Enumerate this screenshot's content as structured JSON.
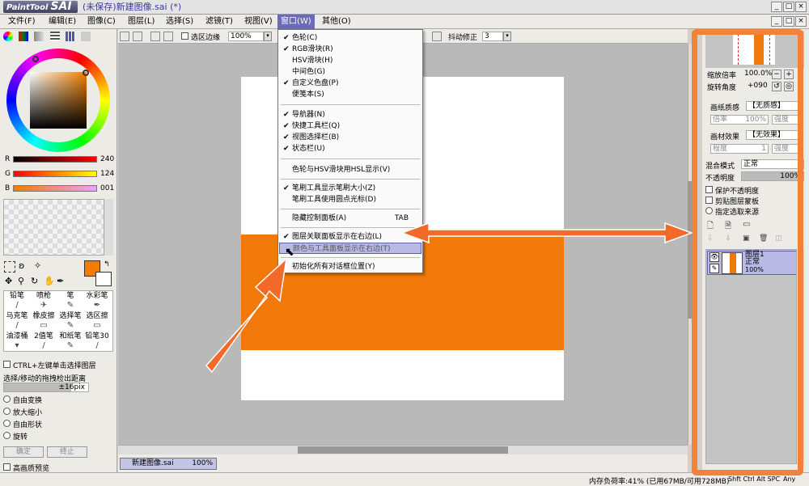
{
  "app": {
    "logo_text": "PaintTool",
    "logo_brand": "SAI",
    "window_title": "(未保存)新建图像.sai (*)"
  },
  "menubar": {
    "items": [
      "文件(F)",
      "编辑(E)",
      "图像(C)",
      "图层(L)",
      "选择(S)",
      "滤镜(T)",
      "视图(V)",
      "窗口(W)",
      "其他(O)"
    ],
    "active": "窗口(W)"
  },
  "dropdown": {
    "items": [
      {
        "label": "色轮(C)",
        "checked": true
      },
      {
        "label": "RGB滑块(R)",
        "checked": true
      },
      {
        "label": "HSV滑块(H)",
        "checked": false
      },
      {
        "label": "中间色(G)",
        "checked": false
      },
      {
        "label": "自定义色盘(P)",
        "checked": true
      },
      {
        "label": "便笺本(S)",
        "checked": false
      },
      {
        "label": "导航器(N)",
        "checked": true
      },
      {
        "label": "快捷工具栏(Q)",
        "checked": true
      },
      {
        "label": "视图选择栏(B)",
        "checked": true
      },
      {
        "label": "状态栏(U)",
        "checked": true
      },
      {
        "label": "色轮与HSV滑块用HSL显示(V)",
        "checked": false
      },
      {
        "label": "笔刷工具显示笔刷大小(Z)",
        "checked": true
      },
      {
        "label": "笔刷工具使用圆点光标(D)",
        "checked": false
      },
      {
        "label": "隐藏控制面板(A)",
        "checked": false,
        "shortcut": "TAB"
      },
      {
        "label": "图层关联面板显示在右边(L)",
        "checked": true
      },
      {
        "label": "颜色与工具面板显示在右边(T)",
        "checked": false,
        "highlighted": true
      },
      {
        "label": "初始化所有对话框位置(Y)",
        "checked": false
      }
    ]
  },
  "toolbar": {
    "selection_edge_label": "选区边缘",
    "zoom": "100%",
    "stabilizer_label": "抖动修正",
    "stabilizer_value": "3"
  },
  "color": {
    "r_label": "R",
    "r_value": "240",
    "g_label": "G",
    "g_value": "124",
    "b_label": "B",
    "b_value": "001",
    "primary": "#f07c01",
    "accent": "#f0790a"
  },
  "tools": {
    "row1": [
      "铅笔",
      "喷枪",
      "笔",
      "水彩笔"
    ],
    "row2": [
      "马克笔",
      "橡皮擦",
      "选择笔",
      "选区擦"
    ],
    "row3": [
      "油漆桶",
      "2值笔",
      "和纸笔",
      "铅笔30"
    ]
  },
  "left_options": {
    "ctrl_pick": "CTRL+左键单击选择图层",
    "drag_threshold": "选择/移动的拖拽检出距离",
    "drag_value": "±16pix",
    "transforms": [
      "自由变换",
      "放大缩小",
      "自由形状",
      "旋转"
    ],
    "ok_btn": "确定",
    "cancel_btn": "终止",
    "hq_preview": "高画质预览"
  },
  "navigator": {
    "zoom_label": "缩放倍率",
    "zoom_value": "100.0%",
    "angle_label": "旋转角度",
    "angle_value": "+090"
  },
  "layer_props": {
    "texture_label": "画纸质感",
    "texture_value": "【无质感】",
    "rate_label": "倍率",
    "rate_value": "100%",
    "strength_label": "强度",
    "effect_label": "画材效果",
    "effect_value": "【无效果】",
    "degree_label": "程度",
    "degree_value": "1",
    "blend_label": "混合模式",
    "blend_value": "正常",
    "opacity_label": "不透明度",
    "opacity_value": "100%",
    "protect_opacity": "保护不透明度",
    "clip_group": "剪贴图层蒙板",
    "select_source": "指定选取来源"
  },
  "layer": {
    "name": "图层1",
    "mode": "正常",
    "opacity": "100%"
  },
  "doc_tab": {
    "name": "新建图像.sai",
    "zoom": "100%"
  },
  "status": {
    "memory": "内存负荷率:41% (已用67MB/可用728MB)",
    "keys": "Shft Ctrl Alt SPC",
    "any": "Any"
  }
}
